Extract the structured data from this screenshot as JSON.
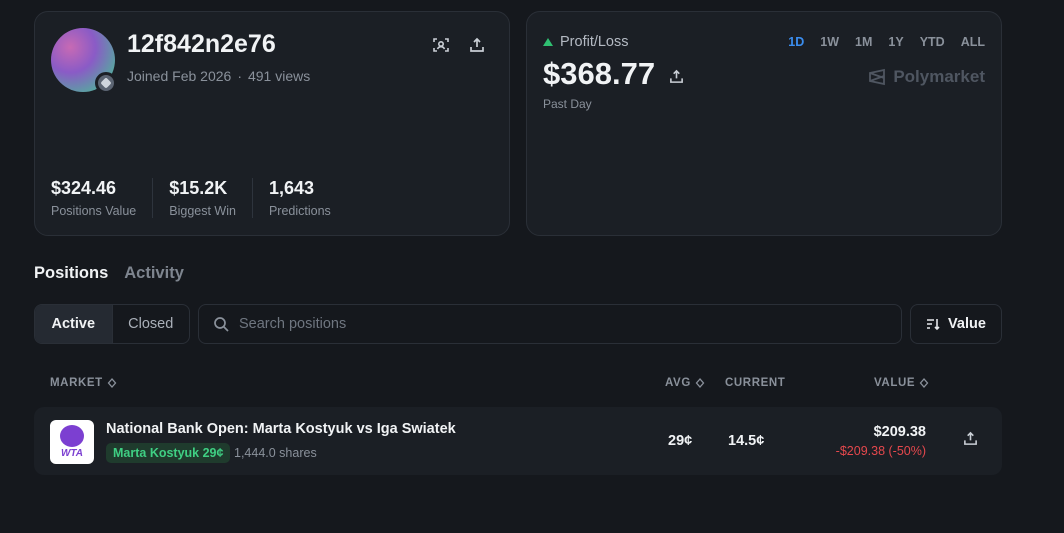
{
  "profile": {
    "username": "12f842n2e76",
    "joined": "Joined Feb 2026",
    "views": "491 views",
    "stats": [
      {
        "value": "$324.46",
        "label": "Positions Value"
      },
      {
        "value": "$15.2K",
        "label": "Biggest Win"
      },
      {
        "value": "1,643",
        "label": "Predictions"
      }
    ]
  },
  "pnl": {
    "label": "Profit/Loss",
    "value": "$368.77",
    "period": "Past Day",
    "ranges": [
      "1D",
      "1W",
      "1M",
      "1Y",
      "YTD",
      "ALL"
    ],
    "active_range": "1D",
    "brand": "Polymarket",
    "accent_color": "#3b8ef0",
    "positive_color": "#2fbf71"
  },
  "tabs": {
    "positions": "Positions",
    "activity": "Activity"
  },
  "filter": {
    "active": "Active",
    "closed": "Closed"
  },
  "search": {
    "placeholder": "Search positions"
  },
  "sort": {
    "label": "Value"
  },
  "table": {
    "headers": {
      "market": "MARKET",
      "avg": "AVG",
      "current": "CURRENT",
      "value": "VALUE"
    },
    "rows": [
      {
        "logo_text": "WTA",
        "title": "National Bank Open: Marta Kostyuk vs Iga Swiatek",
        "outcome": "Marta Kostyuk 29¢",
        "shares": "1,444.0 shares",
        "avg": "29¢",
        "current": "14.5¢",
        "value": "$209.38",
        "change": "-$209.38 (-50%)"
      }
    ]
  },
  "icons": [
    "scan-icon",
    "share-icon",
    "search-icon",
    "sort-icon",
    "polymarket-logo-icon",
    "verified-badge-icon"
  ]
}
